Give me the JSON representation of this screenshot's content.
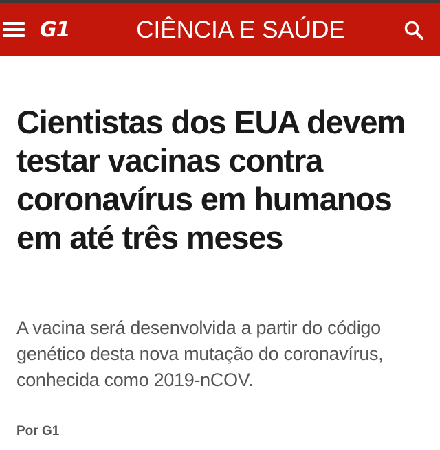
{
  "header": {
    "logo_text": "G1",
    "section_title": "CIÊNCIA E SAÚDE",
    "menu_icon": "hamburger-menu-icon",
    "search_icon": "search-icon",
    "background_color": "#c4170c"
  },
  "article": {
    "headline": "Cientistas dos EUA devem testar vacinas contra coronavírus em humanos em até três meses",
    "subtitle": "A vacina será desenvolvida a partir do código genético desta nova mutação do coronavírus, conhecida como 2019-nCOV.",
    "byline": "Por G1"
  }
}
